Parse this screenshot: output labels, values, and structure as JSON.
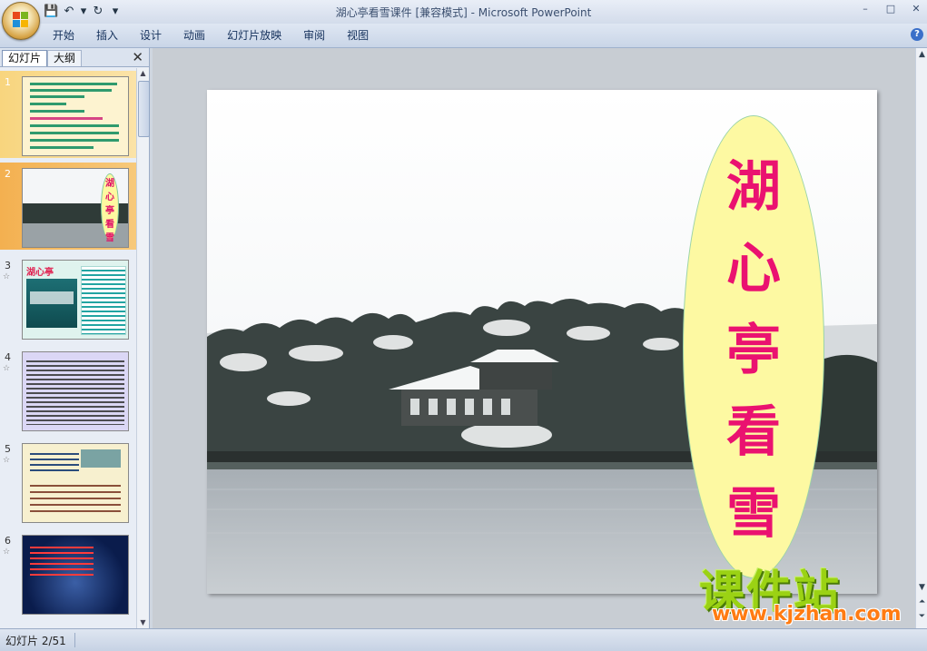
{
  "window": {
    "title": "湖心亭看雪课件 [兼容模式] - Microsoft PowerPoint",
    "controls": [
      "–",
      "□",
      "✕"
    ]
  },
  "quick_access": {
    "icons": [
      "save-icon",
      "undo-icon",
      "dropdown-icon",
      "redo-icon",
      "customize-icon"
    ],
    "glyphs": [
      "💾",
      "↶",
      "▾",
      "↻",
      "▾"
    ]
  },
  "ribbon": {
    "tabs": [
      "开始",
      "插入",
      "设计",
      "动画",
      "幻灯片放映",
      "审阅",
      "视图"
    ]
  },
  "left_panel": {
    "tab_slides": "幻灯片",
    "tab_outline": "大纲",
    "close": "✕",
    "slides": [
      {
        "num": "1"
      },
      {
        "num": "2",
        "title_chars": [
          "湖",
          "心",
          "亭",
          "看",
          "雪"
        ]
      },
      {
        "num": "3",
        "title": "湖心亭"
      },
      {
        "num": "4"
      },
      {
        "num": "5"
      },
      {
        "num": "6"
      }
    ],
    "selected_slide": "2"
  },
  "slide": {
    "title_chars": [
      "湖",
      "心",
      "亭",
      "看",
      "雪"
    ]
  },
  "watermark": {
    "main": "课件站",
    "sub": "www.kjzhan.com"
  },
  "status": {
    "text": "幻灯片 2/51"
  },
  "colors": {
    "title_text": "#ea1270",
    "oval_fill": "#fdf9a2",
    "watermark_green": "#9bd214",
    "watermark_orange": "#ff7b12"
  }
}
